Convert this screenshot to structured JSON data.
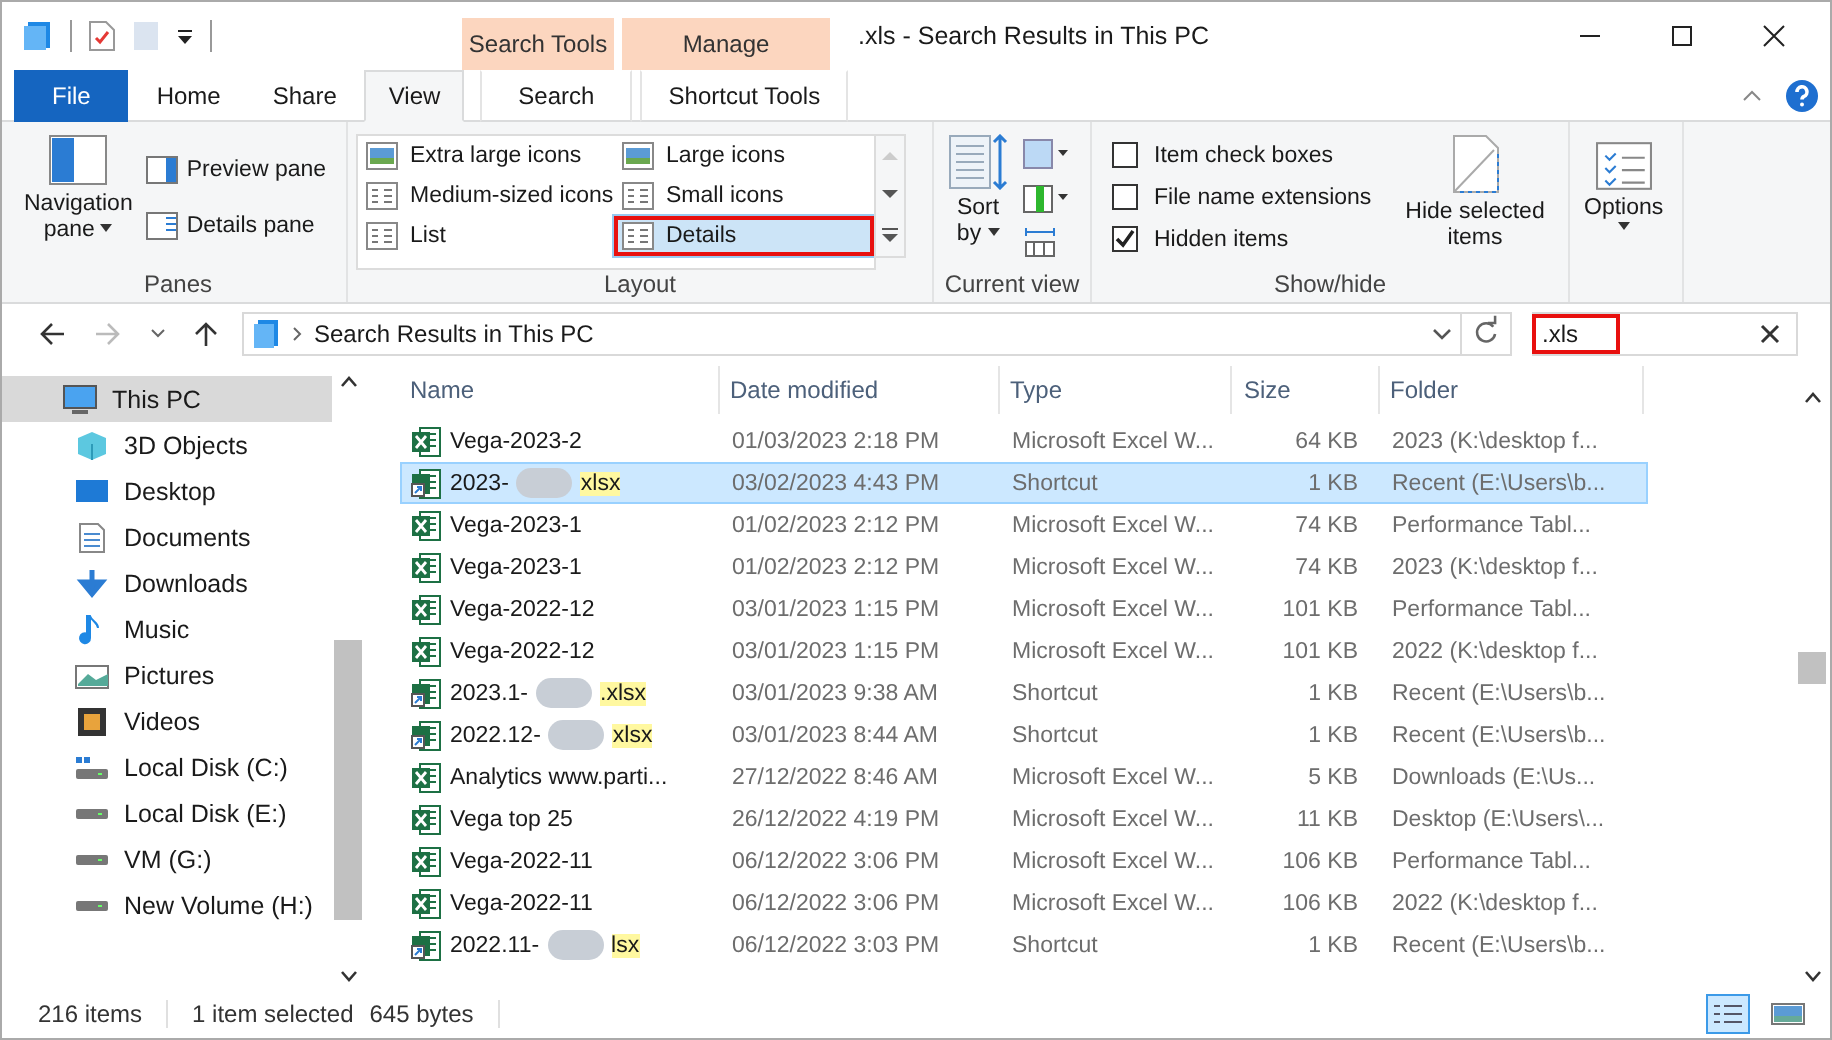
{
  "window": {
    "title": ".xls - Search Results in This PC"
  },
  "tabs": [
    {
      "label": "File",
      "kind": "file",
      "selected": false
    },
    {
      "label": "Home",
      "kind": "normal",
      "selected": false
    },
    {
      "label": "Share",
      "kind": "normal",
      "selected": false
    },
    {
      "label": "View",
      "kind": "normal",
      "selected": true
    },
    {
      "label": "Search",
      "kind": "context",
      "header": "Search Tools",
      "selected": false
    },
    {
      "label": "Shortcut Tools",
      "kind": "context",
      "header": "Manage",
      "selected": false
    }
  ],
  "ribbon": {
    "panes": {
      "navigation": "Navigation",
      "navigation_2": "pane",
      "preview": "Preview pane",
      "details": "Details pane",
      "group": "Panes"
    },
    "layout": {
      "items": [
        {
          "label": "Extra large icons",
          "selected": false,
          "marked": false
        },
        {
          "label": "Large icons",
          "selected": false,
          "marked": false
        },
        {
          "label": "Medium-sized icons",
          "selected": false,
          "marked": false
        },
        {
          "label": "Small icons",
          "selected": false,
          "marked": false
        },
        {
          "label": "List",
          "selected": false,
          "marked": false
        },
        {
          "label": "Details",
          "selected": true,
          "marked": true
        }
      ],
      "group": "Layout"
    },
    "current_view": {
      "sort": "Sort",
      "sort_2": "by",
      "group": "Current view"
    },
    "show_hide": {
      "checks": [
        {
          "label": "Item check boxes",
          "checked": false
        },
        {
          "label": "File name extensions",
          "checked": false
        },
        {
          "label": "Hidden items",
          "checked": true
        }
      ],
      "hide": "Hide selected",
      "hide_2": "items",
      "group": "Show/hide"
    },
    "options": {
      "label": "Options"
    }
  },
  "address": {
    "path": "Search Results in This PC"
  },
  "search": {
    "value": ".xls",
    "marked": true
  },
  "sidebar": {
    "items": [
      {
        "label": "This PC",
        "selected": true
      },
      {
        "label": "3D Objects",
        "selected": false
      },
      {
        "label": "Desktop",
        "selected": false
      },
      {
        "label": "Documents",
        "selected": false
      },
      {
        "label": "Downloads",
        "selected": false
      },
      {
        "label": "Music",
        "selected": false
      },
      {
        "label": "Pictures",
        "selected": false
      },
      {
        "label": "Videos",
        "selected": false
      },
      {
        "label": "Local Disk (C:)",
        "selected": false
      },
      {
        "label": "Local Disk (E:)",
        "selected": false
      },
      {
        "label": "VM (G:)",
        "selected": false
      },
      {
        "label": "New Volume (H:)",
        "selected": false
      }
    ]
  },
  "table": {
    "columns": [
      "Name",
      "Date modified",
      "Type",
      "Size",
      "Folder"
    ],
    "rows": [
      {
        "kind": "excel",
        "name": "Vega-2023-2",
        "date": "01/03/2023 2:18 PM",
        "type": "Microsoft Excel W...",
        "size": "64 KB",
        "folder": "2023 (K:\\desktop f...",
        "selected": false
      },
      {
        "kind": "shortcut",
        "name": "2023-",
        "name_end": "xlsx",
        "date": "03/02/2023 4:43 PM",
        "type": "Shortcut",
        "size": "1 KB",
        "folder": "Recent (E:\\Users\\b...",
        "selected": true
      },
      {
        "kind": "excel",
        "name": "Vega-2023-1",
        "date": "01/02/2023 2:12 PM",
        "type": "Microsoft Excel W...",
        "size": "74 KB",
        "folder": "Performance Tabl...",
        "selected": false
      },
      {
        "kind": "excel",
        "name": "Vega-2023-1",
        "date": "01/02/2023 2:12 PM",
        "type": "Microsoft Excel W...",
        "size": "74 KB",
        "folder": "2023 (K:\\desktop f...",
        "selected": false
      },
      {
        "kind": "excel",
        "name": "Vega-2022-12",
        "date": "03/01/2023 1:15 PM",
        "type": "Microsoft Excel W...",
        "size": "101 KB",
        "folder": "Performance Tabl...",
        "selected": false
      },
      {
        "kind": "excel",
        "name": "Vega-2022-12",
        "date": "03/01/2023 1:15 PM",
        "type": "Microsoft Excel W...",
        "size": "101 KB",
        "folder": "2022 (K:\\desktop f...",
        "selected": false
      },
      {
        "kind": "shortcut",
        "name": "2023.1-",
        "name_end": ".xlsx",
        "date": "03/01/2023 9:38 AM",
        "type": "Shortcut",
        "size": "1 KB",
        "folder": "Recent (E:\\Users\\b...",
        "selected": false
      },
      {
        "kind": "shortcut",
        "name": "2022.12-",
        "name_end": "xlsx",
        "date": "03/01/2023 8:44 AM",
        "type": "Shortcut",
        "size": "1 KB",
        "folder": "Recent (E:\\Users\\b...",
        "selected": false
      },
      {
        "kind": "excel",
        "name": "Analytics www.parti...",
        "date": "27/12/2022 8:46 AM",
        "type": "Microsoft Excel W...",
        "size": "5 KB",
        "folder": "Downloads (E:\\Us...",
        "selected": false
      },
      {
        "kind": "excel",
        "name": "Vega top 25",
        "date": "26/12/2022 4:19 PM",
        "type": "Microsoft Excel W...",
        "size": "11 KB",
        "folder": "Desktop (E:\\Users\\...",
        "selected": false
      },
      {
        "kind": "excel",
        "name": "Vega-2022-11",
        "date": "06/12/2022 3:06 PM",
        "type": "Microsoft Excel W...",
        "size": "106 KB",
        "folder": "Performance Tabl...",
        "selected": false
      },
      {
        "kind": "excel",
        "name": "Vega-2022-11",
        "date": "06/12/2022 3:06 PM",
        "type": "Microsoft Excel W...",
        "size": "106 KB",
        "folder": "2022 (K:\\desktop f...",
        "selected": false
      },
      {
        "kind": "shortcut",
        "name": "2022.11-",
        "name_end": "lsx",
        "date": "06/12/2022 3:03 PM",
        "type": "Shortcut",
        "size": "1 KB",
        "folder": "Recent (E:\\Users\\b...",
        "selected": false
      }
    ]
  },
  "status_bar": {
    "count": "216 items",
    "selection": "1 item selected",
    "size": "645 bytes",
    "views": [
      {
        "kind": "details",
        "selected": true
      },
      {
        "kind": "icons",
        "selected": false
      }
    ]
  }
}
